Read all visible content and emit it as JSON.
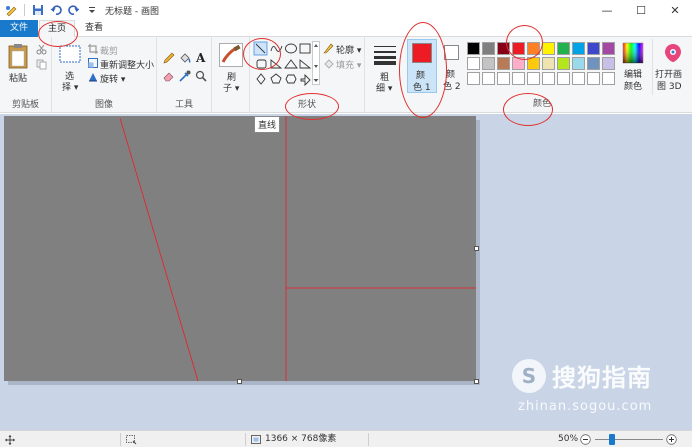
{
  "window": {
    "title": "无标题 - 画图",
    "controls": {
      "minimize": "—",
      "maximize": "☐",
      "close": "✕"
    }
  },
  "tabs": [
    {
      "label": "文件"
    },
    {
      "label": "主页"
    },
    {
      "label": "查看"
    }
  ],
  "ribbon": {
    "clipboard": {
      "paste_label": "粘贴",
      "group_label": "剪贴板"
    },
    "image": {
      "select_label_1": "选",
      "select_label_2": "择 ▾",
      "crop_label": "裁剪",
      "resize_label": "重新调整大小",
      "rotate_label": "旋转 ▾",
      "group_label": "图像"
    },
    "tools": {
      "group_label": "工具"
    },
    "brushes": {
      "label_1": "刷",
      "label_2": "子 ▾"
    },
    "shapes": {
      "outline_label": "轮廓 ▾",
      "fill_label": "填充 ▾",
      "group_label": "形状",
      "tooltip": "直线"
    },
    "size": {
      "label_1": "粗",
      "label_2": "细 ▾"
    },
    "color1": {
      "label_1": "颜",
      "label_2": "色 1",
      "value": "#ed1c24"
    },
    "color2": {
      "label_1": "颜",
      "label_2": "色 2",
      "value": "#ffffff"
    },
    "colors": {
      "group_label": "颜色",
      "palette": [
        "#000000",
        "#7f7f7f",
        "#880015",
        "#ed1c24",
        "#ff7f27",
        "#fff200",
        "#22b14c",
        "#00a2e8",
        "#3f48cc",
        "#a349a4",
        "#ffffff",
        "#c3c3c3",
        "#b97a57",
        "#ffaec9",
        "#ffc90e",
        "#efe4b0",
        "#b5e61d",
        "#99d9ea",
        "#7092be",
        "#c8bfe7",
        "#ffffff",
        "#ffffff",
        "#ffffff",
        "#ffffff",
        "#ffffff",
        "#ffffff",
        "#ffffff",
        "#ffffff",
        "#ffffff",
        "#ffffff"
      ]
    },
    "edit_colors": {
      "label_1": "编辑",
      "label_2": "颜色"
    },
    "paint3d": {
      "label_1": "打开画",
      "label_2": "图 3D"
    }
  },
  "canvas": {
    "background": "#808080",
    "stroke_color": "#ed1c24"
  },
  "statusbar": {
    "dimensions": "1366 × 768像素",
    "zoom": "50%"
  },
  "watermark": {
    "symbol": "S",
    "brand": "搜狗指南",
    "url": "zhinan.sogou.com"
  }
}
